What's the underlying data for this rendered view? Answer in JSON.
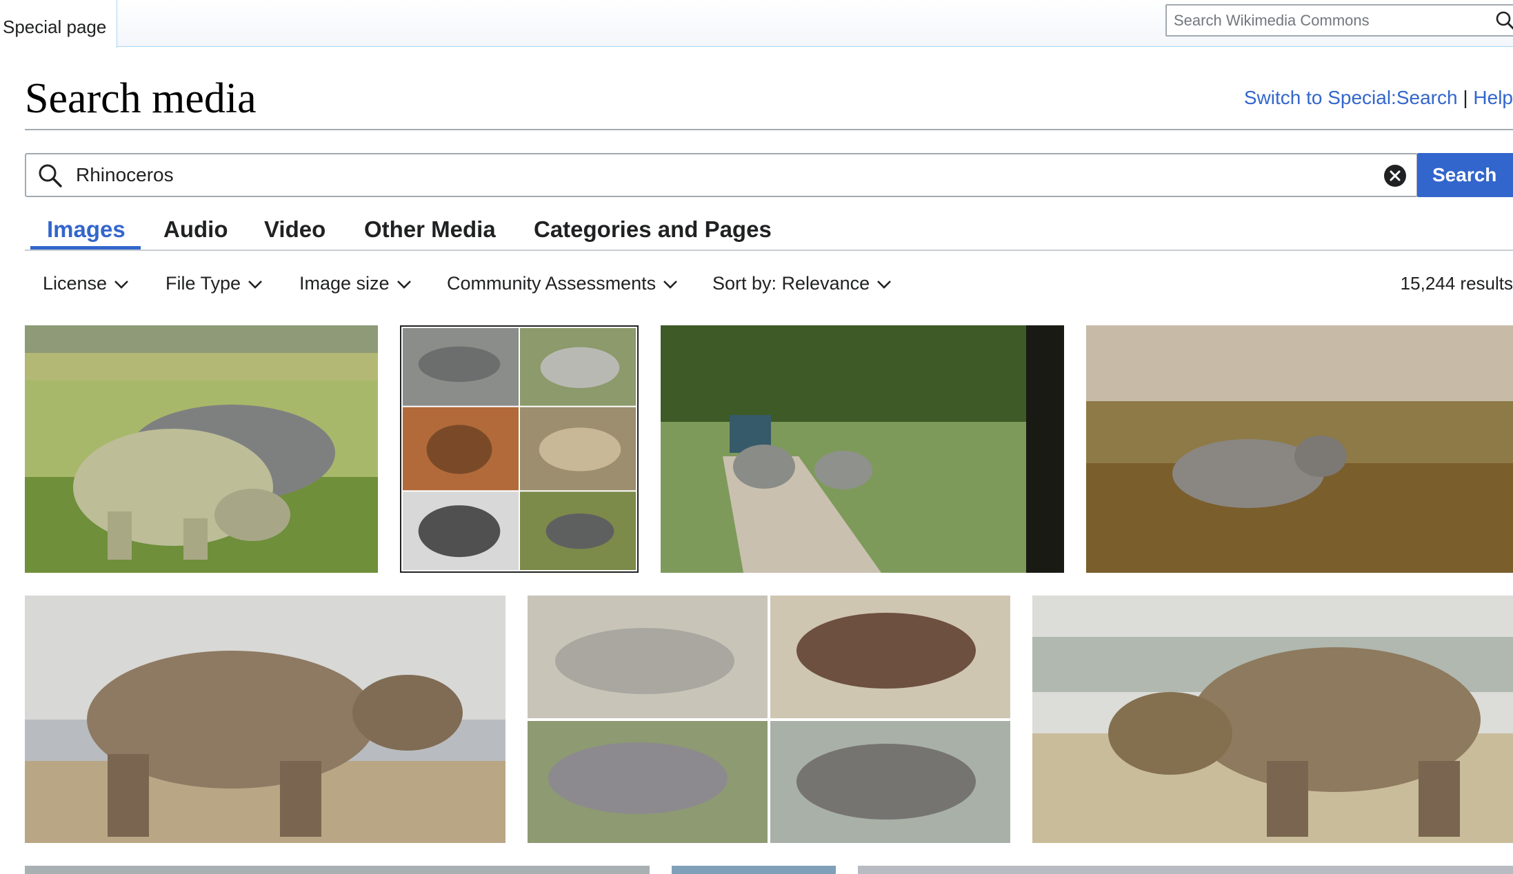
{
  "header": {
    "special_tab": "Special page",
    "search_placeholder": "Search Wikimedia Commons"
  },
  "page": {
    "title": "Search media",
    "switch_link": "Switch to Special:Search",
    "separator": "|",
    "help_link": "Help"
  },
  "search": {
    "value": "Rhinoceros",
    "button_label": "Search"
  },
  "tabs": [
    {
      "label": "Images",
      "active": true
    },
    {
      "label": "Audio"
    },
    {
      "label": "Video"
    },
    {
      "label": "Other Media"
    },
    {
      "label": "Categories and Pages"
    }
  ],
  "filters": [
    {
      "label": "License"
    },
    {
      "label": "File Type"
    },
    {
      "label": "Image size"
    },
    {
      "label": "Community Assessments"
    },
    {
      "label": "Sort by: Relevance"
    }
  ],
  "results_count": "15,244 results",
  "colors": {
    "accent": "#3366cc",
    "text": "#202122",
    "border": "#a2a9b1"
  },
  "icons": [
    "search-icon",
    "clear-icon",
    "chevron-down-icon"
  ]
}
